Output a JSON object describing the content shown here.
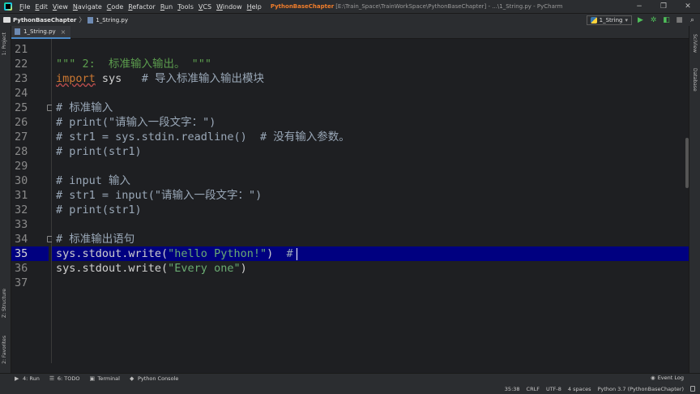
{
  "menu": [
    "File",
    "Edit",
    "View",
    "Navigate",
    "Code",
    "Refactor",
    "Run",
    "Tools",
    "VCS",
    "Window",
    "Help"
  ],
  "window": {
    "project": "PythonBaseChapter",
    "title_rest": "[E:\\Train_Space\\TrainWorkSpace\\PythonBaseChapter] - ...\\1_String.py - PyCharm",
    "minimize": "−",
    "maximize": "❐",
    "close": "✕"
  },
  "breadcrumb": {
    "project": "PythonBaseChapter",
    "separator": "〉",
    "file": "1_String.py"
  },
  "run_config": {
    "label": "1_String",
    "arrow": "▾"
  },
  "toolbar_icons": [
    "run-icon",
    "debug-icon",
    "coverage-icon",
    "stop-icon",
    "search-everywhere-icon"
  ],
  "left_tabs": {
    "project": "1: Project",
    "structure": "Z: Structure",
    "favorites": "2: Favorites"
  },
  "right_tabs": {
    "sciview": "SciView",
    "database": "Database"
  },
  "editor_tab": {
    "label": "1_String.py",
    "close": "×"
  },
  "editor": {
    "current_line": 35,
    "lines": [
      {
        "n": "21",
        "parts": []
      },
      {
        "n": "22",
        "parts": [
          {
            "t": "\"\"\" 2:  标准输入输出。 \"\"\"",
            "c": "doc"
          }
        ]
      },
      {
        "n": "23",
        "parts": [
          {
            "t": "import",
            "c": "kw"
          },
          {
            "t": " sys   ",
            "c": ""
          },
          {
            "t": "# 导入标准输入输出模块",
            "c": "cm"
          }
        ]
      },
      {
        "n": "24",
        "parts": []
      },
      {
        "n": "25",
        "fold": true,
        "parts": [
          {
            "t": "# 标准输入",
            "c": "cm"
          }
        ]
      },
      {
        "n": "26",
        "parts": [
          {
            "t": "# print(\"请输入一段文字：\")",
            "c": "cm"
          }
        ]
      },
      {
        "n": "27",
        "parts": [
          {
            "t": "# str1 = sys.stdin.readline()  # 没有输入参数。",
            "c": "cm"
          }
        ]
      },
      {
        "n": "28",
        "parts": [
          {
            "t": "# print(str1)",
            "c": "cm"
          }
        ]
      },
      {
        "n": "29",
        "parts": []
      },
      {
        "n": "30",
        "parts": [
          {
            "t": "# input 输入",
            "c": "cm"
          }
        ]
      },
      {
        "n": "31",
        "parts": [
          {
            "t": "# str1 = input(\"请输入一段文字：\")",
            "c": "cm"
          }
        ]
      },
      {
        "n": "32",
        "parts": [
          {
            "t": "# print(str1)",
            "c": "cm"
          }
        ]
      },
      {
        "n": "33",
        "parts": []
      },
      {
        "n": "34",
        "fold": true,
        "parts": [
          {
            "t": "# 标准输出语句",
            "c": "cm"
          }
        ]
      },
      {
        "n": "35",
        "parts": [
          {
            "t": "sys.stdout.write(",
            "c": ""
          },
          {
            "t": "\"hello Python!\"",
            "c": "str"
          },
          {
            "t": ")  ",
            "c": ""
          },
          {
            "t": "#",
            "c": "cm"
          }
        ]
      },
      {
        "n": "36",
        "parts": [
          {
            "t": "sys.stdout.write(",
            "c": ""
          },
          {
            "t": "\"Every one\"",
            "c": "str"
          },
          {
            "t": ")",
            "c": ""
          }
        ]
      },
      {
        "n": "37",
        "parts": []
      }
    ]
  },
  "bottom_tabs": [
    {
      "icon": "run-icon",
      "label": "4: Run",
      "glyph": "▶"
    },
    {
      "icon": "todo-icon",
      "label": "6: TODO",
      "glyph": "☰"
    },
    {
      "icon": "terminal-icon",
      "label": "Terminal",
      "glyph": "▣"
    },
    {
      "icon": "python-console-icon",
      "label": "Python Console",
      "glyph": "◆"
    }
  ],
  "event_log": "Event Log",
  "status": {
    "position": "35:38",
    "line_sep": "CRLF",
    "encoding": "UTF-8",
    "indent": "4 spaces",
    "interpreter": "Python 3.7 (PythonBaseChapter)"
  },
  "colors": {
    "accent": "#4a88c7",
    "current_line": "#000080",
    "title_project": "#f07d2b"
  }
}
